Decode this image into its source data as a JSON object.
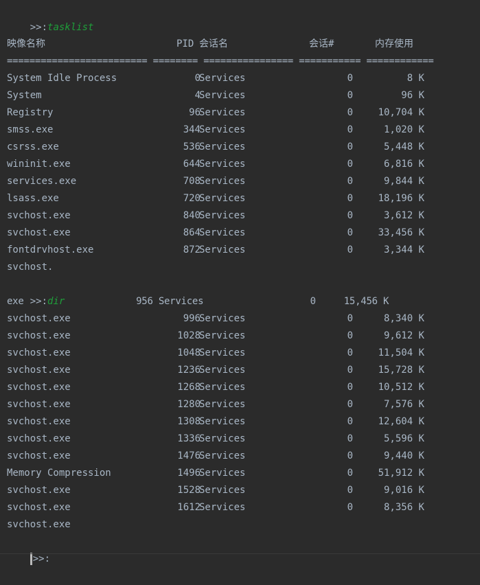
{
  "prompt": {
    "symbol": ">>:",
    "first_command": "tasklist",
    "second_command": "dir"
  },
  "headers": {
    "image_name": "映像名称",
    "pid": "PID",
    "session_name": "会话名",
    "session_num": "会话#",
    "mem_usage": "内存使用",
    "separator": "========================= ======== ================ =========== ============"
  },
  "rows_a": [
    {
      "name": "System Idle Process",
      "pid": "0",
      "session": "Services",
      "num": "0",
      "mem": "8 K"
    },
    {
      "name": "System",
      "pid": "4",
      "session": "Services",
      "num": "0",
      "mem": "96 K"
    },
    {
      "name": "Registry",
      "pid": "96",
      "session": "Services",
      "num": "0",
      "mem": "10,704 K"
    },
    {
      "name": "smss.exe",
      "pid": "344",
      "session": "Services",
      "num": "0",
      "mem": "1,020 K"
    },
    {
      "name": "csrss.exe",
      "pid": "536",
      "session": "Services",
      "num": "0",
      "mem": "5,448 K"
    },
    {
      "name": "wininit.exe",
      "pid": "644",
      "session": "Services",
      "num": "0",
      "mem": "6,816 K"
    },
    {
      "name": "services.exe",
      "pid": "708",
      "session": "Services",
      "num": "0",
      "mem": "9,844 K"
    },
    {
      "name": "lsass.exe",
      "pid": "720",
      "session": "Services",
      "num": "0",
      "mem": "18,196 K"
    },
    {
      "name": "svchost.exe",
      "pid": "840",
      "session": "Services",
      "num": "0",
      "mem": "3,612 K"
    },
    {
      "name": "svchost.exe",
      "pid": "864",
      "session": "Services",
      "num": "0",
      "mem": "33,456 K"
    },
    {
      "name": "fontdrvhost.exe",
      "pid": "872",
      "session": "Services",
      "num": "0",
      "mem": "3,344 K"
    }
  ],
  "fragment_before": "svchost.",
  "broken_line": "exe                    956 Services                   0     15,456 K",
  "rows_b": [
    {
      "name": "svchost.exe",
      "pid": "996",
      "session": "Services",
      "num": "0",
      "mem": "8,340 K"
    },
    {
      "name": "svchost.exe",
      "pid": "1028",
      "session": "Services",
      "num": "0",
      "mem": "9,612 K"
    },
    {
      "name": "svchost.exe",
      "pid": "1048",
      "session": "Services",
      "num": "0",
      "mem": "11,504 K"
    },
    {
      "name": "svchost.exe",
      "pid": "1236",
      "session": "Services",
      "num": "0",
      "mem": "15,728 K"
    },
    {
      "name": "svchost.exe",
      "pid": "1268",
      "session": "Services",
      "num": "0",
      "mem": "10,512 K"
    },
    {
      "name": "svchost.exe",
      "pid": "1280",
      "session": "Services",
      "num": "0",
      "mem": "7,576 K"
    },
    {
      "name": "svchost.exe",
      "pid": "1308",
      "session": "Services",
      "num": "0",
      "mem": "12,604 K"
    },
    {
      "name": "svchost.exe",
      "pid": "1336",
      "session": "Services",
      "num": "0",
      "mem": "5,596 K"
    },
    {
      "name": "svchost.exe",
      "pid": "1476",
      "session": "Services",
      "num": "0",
      "mem": "9,440 K"
    },
    {
      "name": "Memory Compression",
      "pid": "1496",
      "session": "Services",
      "num": "0",
      "mem": "51,912 K"
    },
    {
      "name": "svchost.exe",
      "pid": "1528",
      "session": "Services",
      "num": "0",
      "mem": "9,016 K"
    },
    {
      "name": "svchost.exe",
      "pid": "1612",
      "session": "Services",
      "num": "0",
      "mem": "8,356 K"
    }
  ],
  "fragment_end": "svchost.exe"
}
